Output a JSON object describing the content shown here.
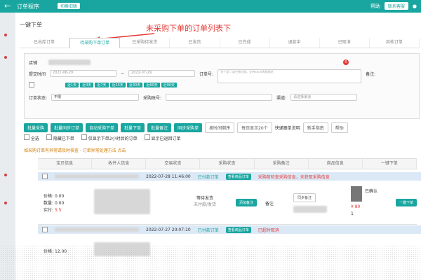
{
  "topbar": {
    "title": "订单程序",
    "badge": "切换旧版",
    "right_label": "帮助",
    "pill": "联系客服"
  },
  "page_title": "一键下单",
  "annotation": "未采购下单的订单列表下",
  "tabs": [
    "已出库订单",
    "待采购下单订单",
    "已采购待发货",
    "已发货",
    "已完成",
    "退款中",
    "已取消",
    "其他订单"
  ],
  "filters": {
    "store_label": "店铺",
    "date_label": "提交时间",
    "date_start": "2022-06-29",
    "date_end": "2022-07-29",
    "order_no_label": "订单号:",
    "order_no_placeholder": "多个用\",\"或空格分隔，支持excel表格粘贴",
    "notes_label": "备注:",
    "status_label": "订单状态:",
    "status_value": "不限",
    "supplier_label": "采购账号:",
    "channel_label": "渠道:",
    "channel_value": "请选择渠道",
    "chips": [
      "近1天",
      "近3天",
      "近7天",
      "近15天",
      "近30天",
      "近60天",
      "近90天"
    ],
    "red_count": "0"
  },
  "actions": [
    "批量采购",
    "批量同步订单",
    "自动采购下单",
    "批量下单",
    "批量备注",
    "同步采购单"
  ],
  "action_selects": [
    "按时间倒序",
    "每页显示20个"
  ],
  "action_links": [
    "快递跟单说明",
    "新手指南",
    "帮助"
  ],
  "options": {
    "select_all": "全选",
    "hide_completed": "隐藏已下单",
    "only_show": "仅显示下单2小时后的订单",
    "include_returned": "显示已退回订单"
  },
  "notice": "如采购订单有异常请及时核查 · 订单异常处理方法 点击",
  "columns": [
    "宝贝信息",
    "收件人信息",
    "交易状态",
    "采购状态",
    "采购备注",
    "商品信息",
    "一键下单"
  ],
  "orders": [
    {
      "time": "2022-07-28 11:46:00",
      "status_text": "已付款订单",
      "status_btn": "查看商品订单",
      "error_text": "采购前检查采购信息，未获取采购信息",
      "price_label": "价格:",
      "price": "0.00",
      "qty_label": "数量:",
      "qty": "0.00",
      "total_label": "实付:",
      "total": "5.5",
      "trade_status": "等待发货",
      "trade_sub": "未付款/发货",
      "remark_btn": "添加备注",
      "remark_tag": "备注",
      "sync_btn": "同步备注",
      "goods_title": "已确认",
      "goods_price": "¥ 80",
      "goods_qty": "1",
      "one_click": "一键下单"
    },
    {
      "time": "2022-07-27 20:07:10",
      "status_text": "已付款订单",
      "status_btn": "查看商品订单",
      "error_text": "已超时取消",
      "price_label": "价格:",
      "price": "12.00"
    }
  ],
  "colors": {
    "accent": "#1aa6a0",
    "annotation": "#e53935",
    "row_head": "#dbe8f6"
  }
}
